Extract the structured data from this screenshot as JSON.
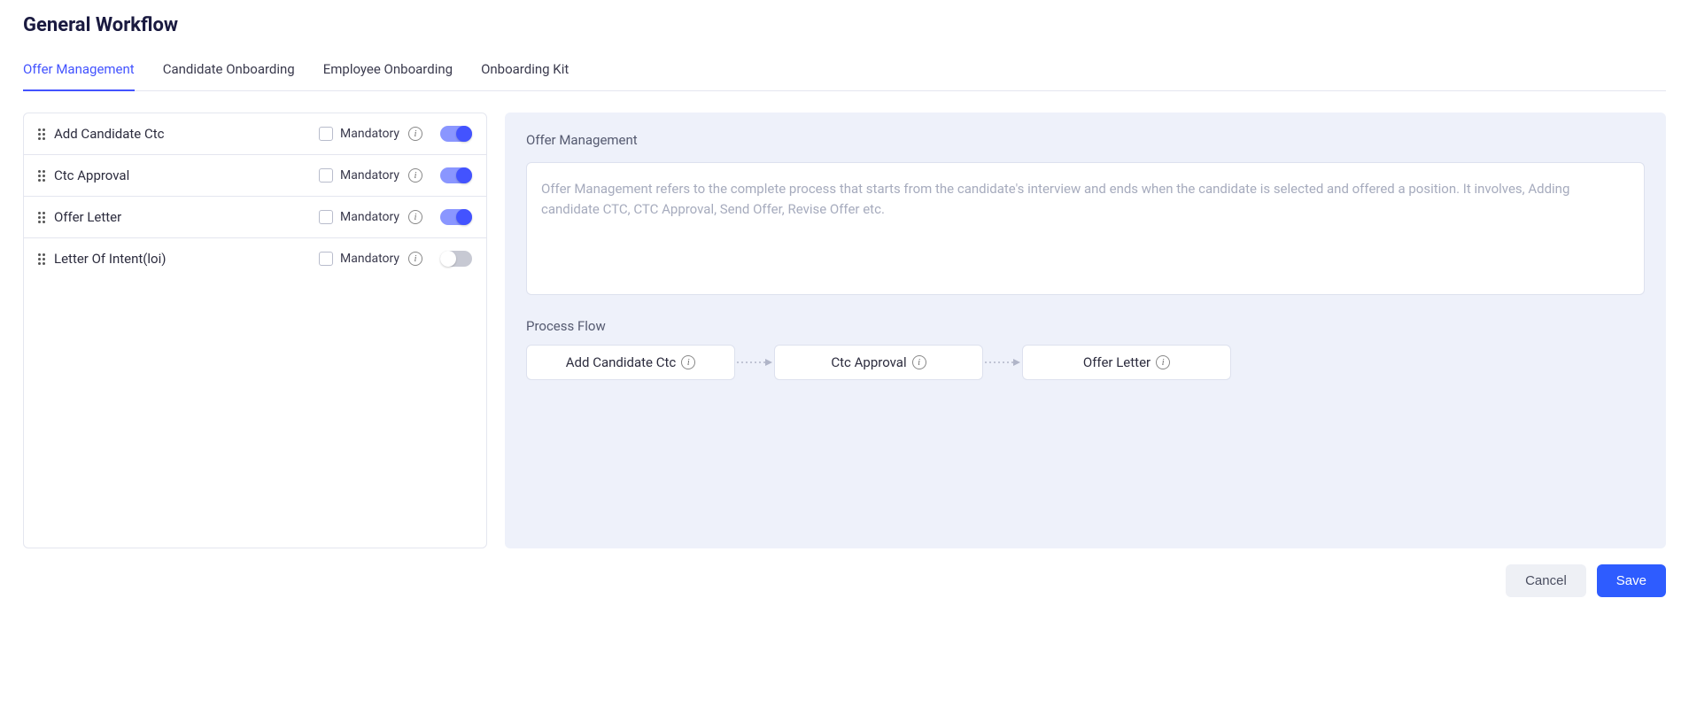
{
  "page_title": "General Workflow",
  "tabs": [
    {
      "label": "Offer Management",
      "active": true
    },
    {
      "label": "Candidate Onboarding",
      "active": false
    },
    {
      "label": "Employee Onboarding",
      "active": false
    },
    {
      "label": "Onboarding Kit",
      "active": false
    }
  ],
  "workflow_items": [
    {
      "label": "Add Candidate Ctc",
      "mandatory_label": "Mandatory",
      "mandatory_checked": false,
      "enabled": true
    },
    {
      "label": "Ctc Approval",
      "mandatory_label": "Mandatory",
      "mandatory_checked": false,
      "enabled": true
    },
    {
      "label": "Offer Letter",
      "mandatory_label": "Mandatory",
      "mandatory_checked": false,
      "enabled": true
    },
    {
      "label": "Letter Of Intent(loi)",
      "mandatory_label": "Mandatory",
      "mandatory_checked": false,
      "enabled": false
    }
  ],
  "right": {
    "section_label": "Offer Management",
    "description": "Offer Management refers to the complete process that starts from the candidate's interview and ends when the candidate is selected and offered a position. It involves, Adding candidate CTC, CTC Approval, Send Offer, Revise Offer etc.",
    "flow_label": "Process Flow",
    "flow_steps": [
      {
        "label": "Add Candidate Ctc"
      },
      {
        "label": "Ctc Approval"
      },
      {
        "label": "Offer Letter"
      }
    ]
  },
  "footer": {
    "cancel": "Cancel",
    "save": "Save"
  }
}
